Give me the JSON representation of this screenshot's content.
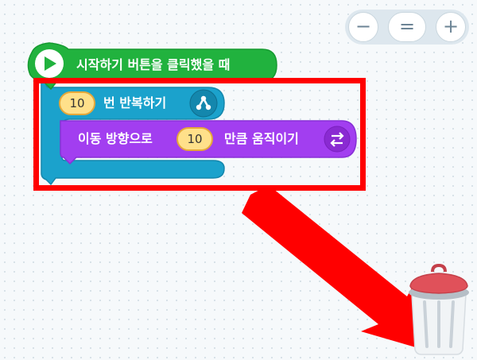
{
  "zoom": {
    "zoom_out_label": "−",
    "reset_label": "=",
    "zoom_in_label": "+"
  },
  "blocks": {
    "start": {
      "label": "시작하기 버튼을 클릭했을 때",
      "icon": "play-icon",
      "color": "#21b23e"
    },
    "repeat": {
      "count": "10",
      "label": "번 반복하기",
      "icon": "repeat-icon",
      "color": "#1ba2cc"
    },
    "move": {
      "prefix": "이동 방향으로",
      "count": "10",
      "suffix": "만큼 움직이기",
      "icon": "move-arrows-icon",
      "color": "#a23ef0"
    }
  },
  "annotations": {
    "highlight_color": "#ff0000"
  },
  "trash": {
    "icon": "trash-can-icon"
  }
}
